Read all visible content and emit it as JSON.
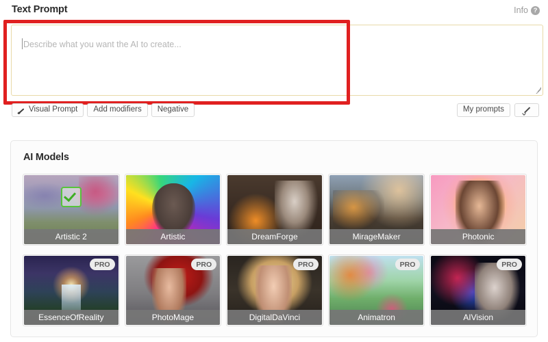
{
  "prompt_section": {
    "title": "Text Prompt",
    "info_label": "Info",
    "info_icon": "question-circle-icon",
    "textarea_value": "",
    "textarea_placeholder": "Describe what you want the AI to create...",
    "left_buttons": [
      {
        "label": "Visual Prompt",
        "icon": "brush-icon"
      },
      {
        "label": "Add modifiers",
        "icon": ""
      },
      {
        "label": "Negative",
        "icon": ""
      }
    ],
    "right_buttons": [
      {
        "label": "My prompts",
        "icon": ""
      },
      {
        "label": "",
        "icon": "pen-icon"
      }
    ]
  },
  "models_section": {
    "title": "AI Models",
    "rows": [
      [
        {
          "name": "Artistic 2",
          "pro": false,
          "selected": true,
          "art": "art-artistic2"
        },
        {
          "name": "Artistic",
          "pro": false,
          "selected": false,
          "art": "art-artistic"
        },
        {
          "name": "DreamForge",
          "pro": false,
          "selected": false,
          "art": "art-dreamforge"
        },
        {
          "name": "MirageMaker",
          "pro": false,
          "selected": false,
          "art": "art-miragemaker"
        },
        {
          "name": "Photonic",
          "pro": false,
          "selected": false,
          "art": "art-photonic"
        }
      ],
      [
        {
          "name": "EssenceOfReality",
          "pro": true,
          "selected": false,
          "art": "art-essence"
        },
        {
          "name": "PhotoMage",
          "pro": true,
          "selected": false,
          "art": "art-photomage"
        },
        {
          "name": "DigitalDaVinci",
          "pro": true,
          "selected": false,
          "art": "art-davinci"
        },
        {
          "name": "Animatron",
          "pro": true,
          "selected": false,
          "art": "art-animatron"
        },
        {
          "name": "AIVision",
          "pro": true,
          "selected": false,
          "art": "art-aivision"
        }
      ]
    ],
    "pro_badge_label": "PRO",
    "selected_icon": "check-icon"
  },
  "annotation": {
    "highlight_color": "#e02020",
    "shape": "rectangle",
    "target": "text-prompt-textarea"
  },
  "colors": {
    "textarea_border": "#e8d9a8",
    "label_bar": "#767676",
    "check_green": "#57c43a",
    "panel_border": "#e6e6e6"
  }
}
